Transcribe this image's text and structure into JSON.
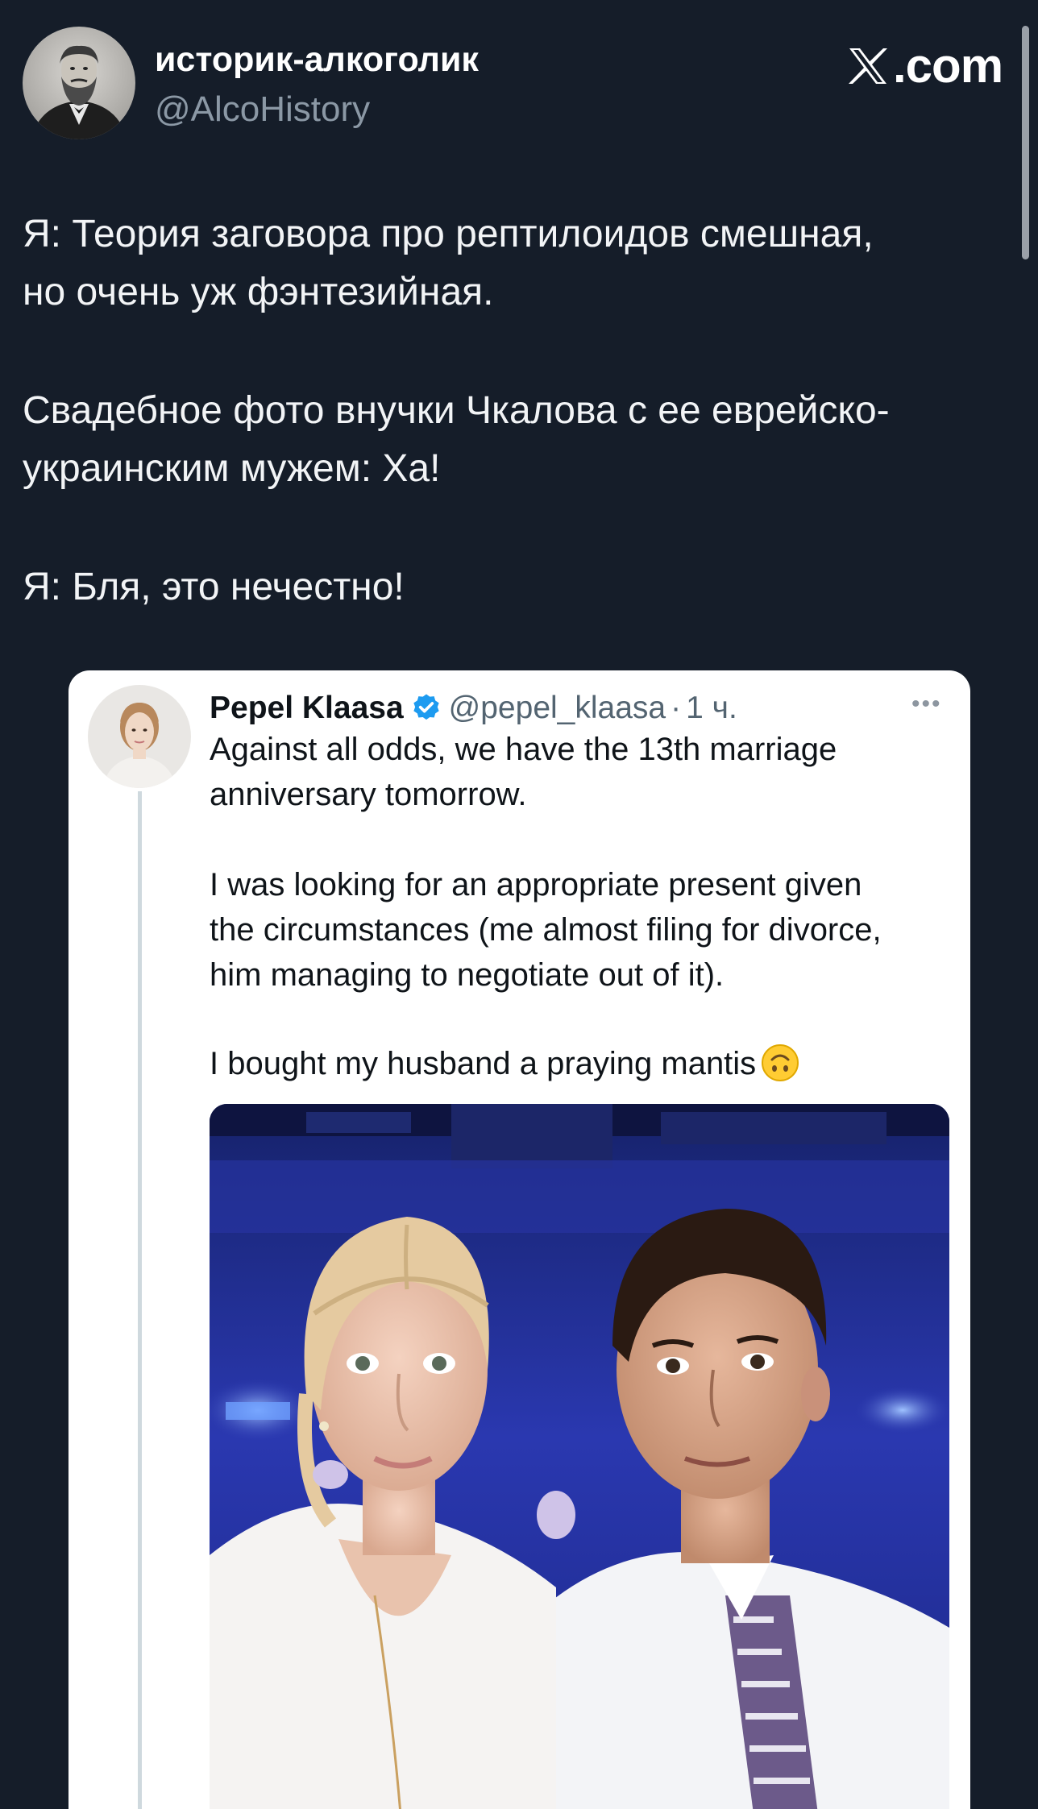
{
  "author": {
    "name": "историк-алкоголик",
    "handle": "@AlcoHistory"
  },
  "site": {
    "logo_text": ".com"
  },
  "tweet": {
    "lines": [
      "Я: Теория заговора про рептилоидов смешная,",
      "но очень уж фэнтезийная.",
      "Свадебное фото внучки Чкалова с ее еврейско-",
      "украинским мужем: Ха!",
      "Я: Бля, это нечестно!"
    ]
  },
  "quote": {
    "name": "Pepel Klaasa",
    "handle": "@pepel_klaasa",
    "separator": "·",
    "time": "1 ч.",
    "more": "•••",
    "lines": [
      "Against all odds, we have the 13th marriage",
      "anniversary tomorrow.",
      "I was looking for an appropriate present given",
      "the circumstances (me almost filing for divorce,",
      "him managing to negotiate out of it).",
      "I bought my husband a praying mantis"
    ],
    "emoji": "upside-down-face",
    "verified_color": "#1d9bf0"
  },
  "icons": {
    "verified": "verified-badge-icon",
    "more": "more-options-icon",
    "logo": "x-logo-icon"
  },
  "colors": {
    "background": "#151d29",
    "card": "#ffffff",
    "secondary_text": "#8b98a5"
  }
}
